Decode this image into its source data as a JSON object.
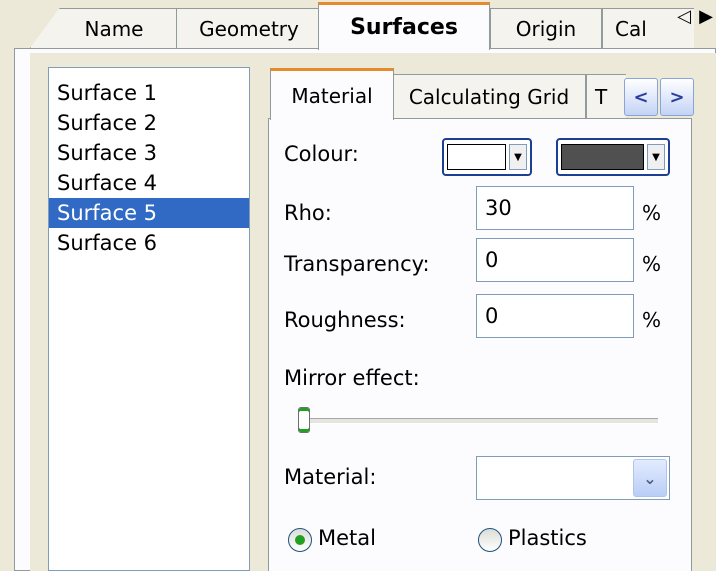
{
  "top_tabs": {
    "items": [
      {
        "label": "Name"
      },
      {
        "label": "Geometry"
      },
      {
        "label": "Surfaces"
      },
      {
        "label": "Origin"
      },
      {
        "label": "Cal"
      }
    ],
    "active": "Surfaces",
    "scroll_left": "◁",
    "scroll_right": "▶"
  },
  "surfaces": {
    "items": [
      "Surface 1",
      "Surface 2",
      "Surface 3",
      "Surface 4",
      "Surface 5",
      "Surface 6"
    ],
    "selected": "Surface 5"
  },
  "inner_tabs": {
    "items": [
      {
        "label": "Material"
      },
      {
        "label": "Calculating Grid"
      },
      {
        "label": "T"
      }
    ],
    "active": "Material",
    "scroll_left": "<",
    "scroll_right": ">"
  },
  "material_page": {
    "colour_label": "Colour:",
    "colour_primary": "#ffffff",
    "colour_secondary": "#505050",
    "rho_label": "Rho:",
    "rho_value": "30",
    "transparency_label": "Transparency:",
    "transparency_value": "0",
    "roughness_label": "Roughness:",
    "roughness_value": "0",
    "unit": "%",
    "mirror_label": "Mirror effect:",
    "mirror_value": 0,
    "material_label": "Material:",
    "material_value": "",
    "radio_metal": "Metal",
    "radio_plastics": "Plastics",
    "radio_selected": "Metal"
  },
  "colors": {
    "accent_tab": "#e68b2c",
    "selection": "#316ac5"
  }
}
